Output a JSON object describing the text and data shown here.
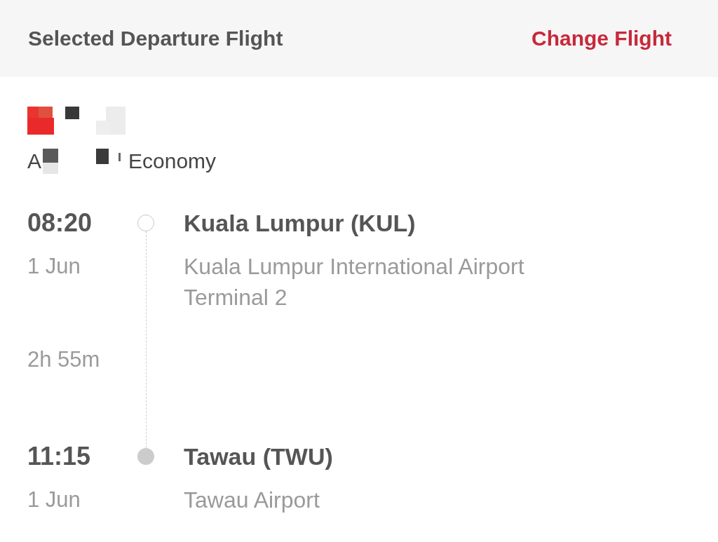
{
  "header": {
    "title": "Selected Departure Flight",
    "action": "Change Flight"
  },
  "fare_line": {
    "start": "A",
    "end": "Economy"
  },
  "departure": {
    "time": "08:20",
    "date": "1 Jun",
    "station": "Kuala Lumpur (KUL)",
    "airport": "Kuala Lumpur International Airport",
    "terminal": "Terminal 2"
  },
  "duration": "2h 55m",
  "arrival": {
    "time": "11:15",
    "date": "1 Jun",
    "station": "Tawau (TWU)",
    "airport": "Tawau Airport"
  }
}
